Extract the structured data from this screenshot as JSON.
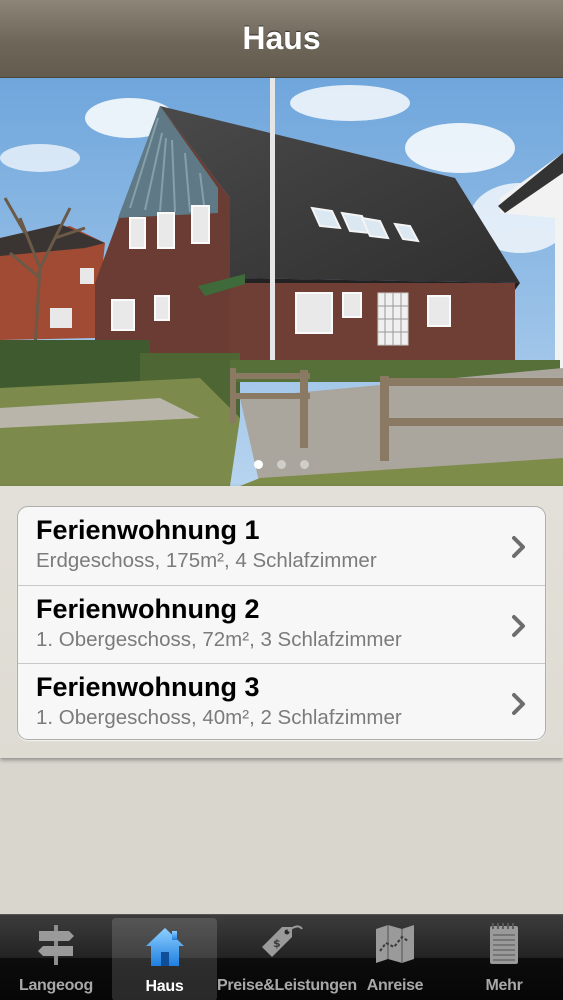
{
  "navbar": {
    "title": "Haus"
  },
  "hero": {
    "image": "house-photo",
    "page_count": 3,
    "active_page": 1
  },
  "apartments": [
    {
      "title": "Ferienwohnung 1",
      "subtitle": "Erdgeschoss, 175m², 4 Schlafzimmer"
    },
    {
      "title": "Ferienwohnung 2",
      "subtitle": "1. Obergeschoss, 72m², 3 Schlafzimmer"
    },
    {
      "title": "Ferienwohnung 3",
      "subtitle": "1. Obergeschoss, 40m², 2 Schlafzimmer"
    }
  ],
  "tabbar": {
    "selected": "Haus",
    "tabs": [
      {
        "label": "Langeoog",
        "icon": "signpost-icon"
      },
      {
        "label": "Haus",
        "icon": "house-icon"
      },
      {
        "label": "Preise&Leistungen",
        "icon": "price-tag-icon"
      },
      {
        "label": "Anreise",
        "icon": "map-icon"
      },
      {
        "label": "Mehr",
        "icon": "notepad-icon"
      }
    ]
  },
  "colors": {
    "navbar": "#6e6759",
    "background": "#d9d6ce",
    "tab_selected_icon": "#4ea3f0",
    "tab_icon": "#9a9a9a"
  }
}
